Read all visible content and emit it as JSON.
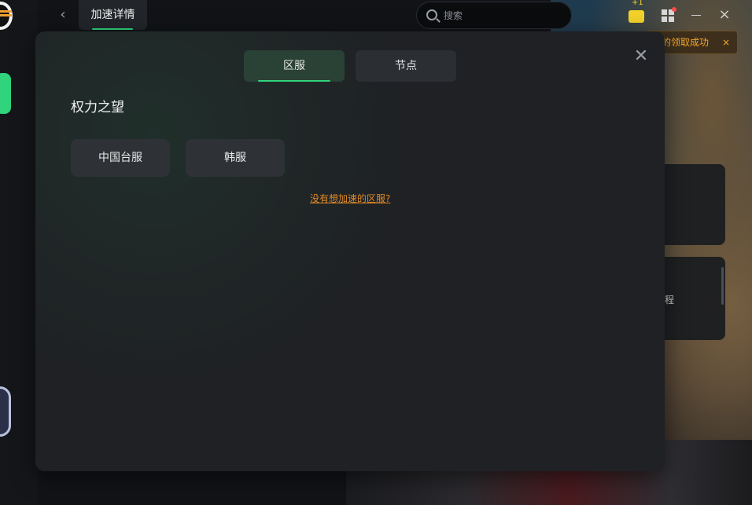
{
  "app": {
    "back_icon": "chevron-left-icon",
    "active_tab_label": "加速详情",
    "search": {
      "placeholder": "搜索",
      "icon": "search-icon"
    },
    "notification": {
      "badge": "+1",
      "text": "的领取成功",
      "close": "×"
    },
    "background_hint_text": "程",
    "window_controls": {
      "minimize": "minimize-icon",
      "close": "×"
    }
  },
  "modal": {
    "tabs": [
      {
        "label": "区服",
        "active": true
      },
      {
        "label": "节点",
        "active": false
      }
    ],
    "close_label": "✕",
    "game_title": "权力之望",
    "regions": [
      {
        "label": "中国台服"
      },
      {
        "label": "韩服"
      }
    ],
    "missing_link": "没有想加速的区服?"
  },
  "colors": {
    "accent": "#2fd47c",
    "link": "#e08a2a",
    "toast": "#f5a72b",
    "modal_bg": "#1f2124"
  }
}
